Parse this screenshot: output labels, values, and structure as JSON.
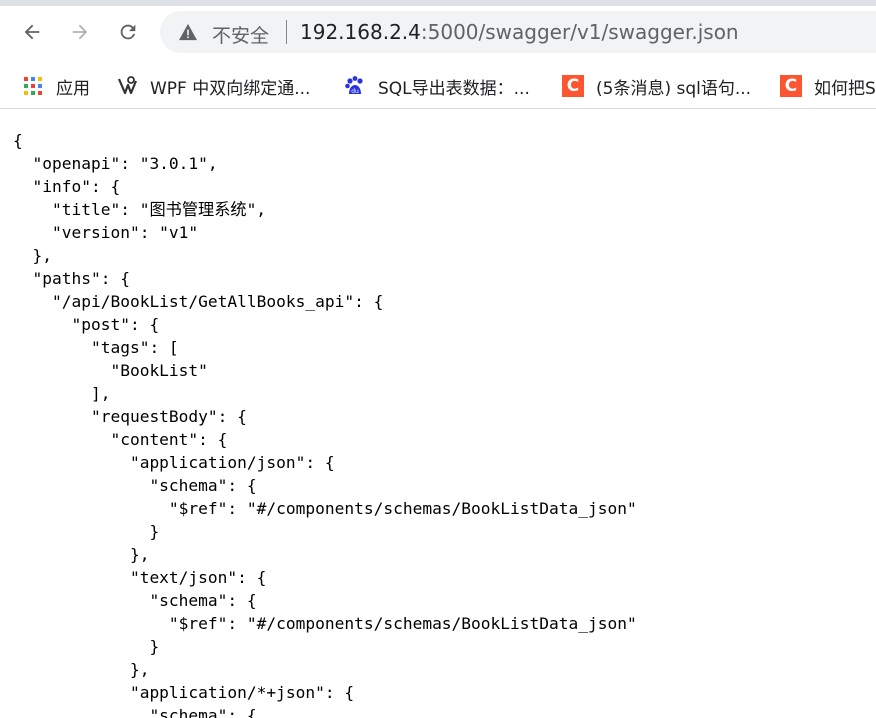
{
  "browser": {
    "insecure_label": "不安全",
    "url_host": "192.168.2.4",
    "url_rest": ":5000/swagger/v1/swagger.json"
  },
  "bookmarks": [
    {
      "icon": "apps-grid-icon",
      "label": "应用"
    },
    {
      "icon": "wpf-icon",
      "label": "WPF 中双向绑定通..."
    },
    {
      "icon": "baidu-icon",
      "label": "SQL导出表数据：..."
    },
    {
      "icon": "csdn-icon",
      "label": "(5条消息) sql语句..."
    },
    {
      "icon": "csdn-icon",
      "label": "如何把S"
    }
  ],
  "json_lines": [
    "{",
    "  \"openapi\": \"3.0.1\",",
    "  \"info\": {",
    "    \"title\": \"图书管理系统\",",
    "    \"version\": \"v1\"",
    "  },",
    "  \"paths\": {",
    "    \"/api/BookList/GetAllBooks_api\": {",
    "      \"post\": {",
    "        \"tags\": [",
    "          \"BookList\"",
    "        ],",
    "        \"requestBody\": {",
    "          \"content\": {",
    "            \"application/json\": {",
    "              \"schema\": {",
    "                \"$ref\": \"#/components/schemas/BookListData_json\"",
    "              }",
    "            },",
    "            \"text/json\": {",
    "              \"schema\": {",
    "                \"$ref\": \"#/components/schemas/BookListData_json\"",
    "              }",
    "            },",
    "            \"application/*+json\": {",
    "              \"schema\": {"
  ]
}
